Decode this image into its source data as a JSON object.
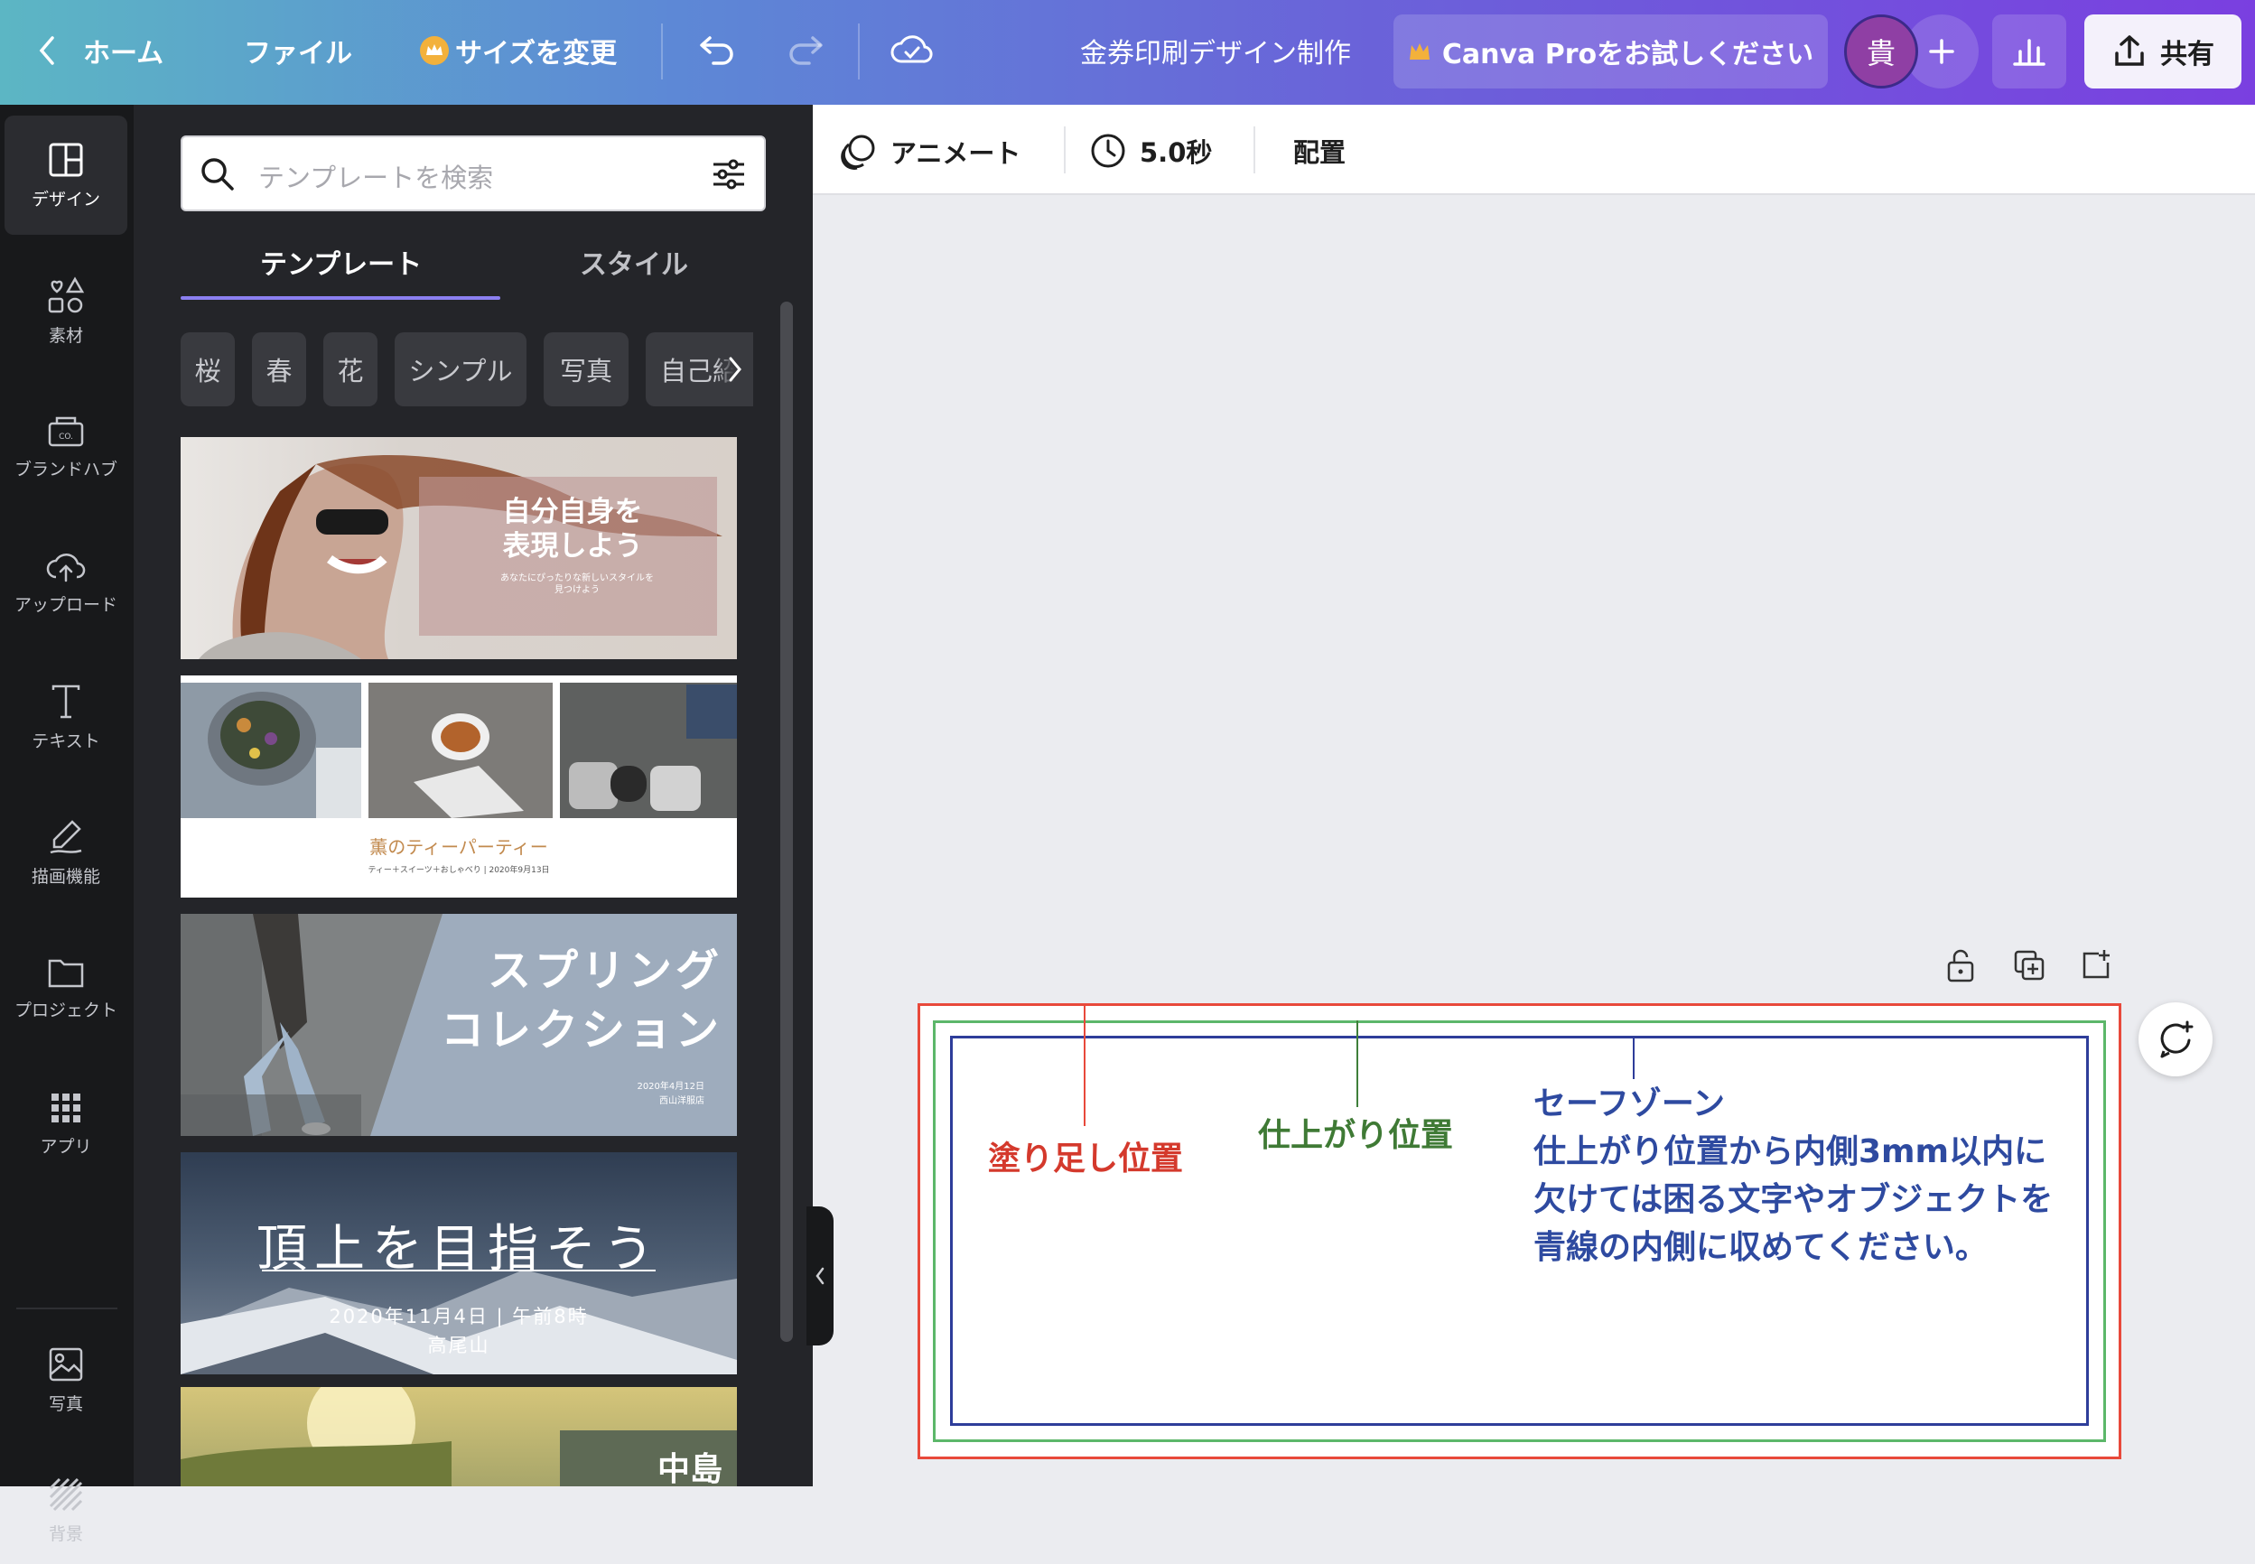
{
  "topbar": {
    "home": "ホーム",
    "file": "ファイル",
    "resize": "サイズを変更",
    "doc_title": "金券印刷デザイン制作",
    "pro_trial": "Canva Proをお試しください",
    "avatar": "貴",
    "share": "共有"
  },
  "rail": {
    "design": "デザイン",
    "elements": "素材",
    "brand": "ブランドハブ",
    "upload": "アップロード",
    "text": "テキスト",
    "draw": "描画機能",
    "projects": "プロジェクト",
    "apps": "アプリ",
    "photos": "写真",
    "background": "背景"
  },
  "panel": {
    "search_placeholder": "テンプレートを検索",
    "tabs": [
      "テンプレート",
      "スタイル"
    ],
    "chips": [
      "桜",
      "春",
      "花",
      "シンプル",
      "写真",
      "自己紹"
    ],
    "templates": [
      {
        "title": "自分自身を表現しよう",
        "line1": "自分自身を",
        "line2": "表現しよう",
        "sub": "あなたにぴったりな新しいスタイルを見つけよう"
      },
      {
        "title": "薫のティーパーティー",
        "sub": "ティー＋スイーツ＋おしゃべり | 2020年9月13日"
      },
      {
        "title1": "スプリング",
        "title2": "コレクション",
        "date": "2020年4月12日",
        "place": "西山洋服店"
      },
      {
        "title": "頂上を目指そう",
        "sub1": "2020年11月4日 | 午前8時",
        "sub2": "高尾山"
      },
      {
        "title": "中島"
      }
    ]
  },
  "toolbar": {
    "animate": "アニメート",
    "duration": "5.0秒",
    "arrange": "配置"
  },
  "canvas": {
    "bleed_label": "塗り足し位置",
    "trim_label": "仕上がり位置",
    "safe_title": "セーフゾーン",
    "safe_line1": "仕上がり位置から内側3mm以内に",
    "safe_line2": "欠けては困る文字やオブジェクトを",
    "safe_line3": "青線の内側に収めてください。",
    "colors": {
      "bleed": "#e8493b",
      "trim": "#5cb76a",
      "safe": "#2e3d9a",
      "safe_text": "#2e4aa0"
    }
  }
}
